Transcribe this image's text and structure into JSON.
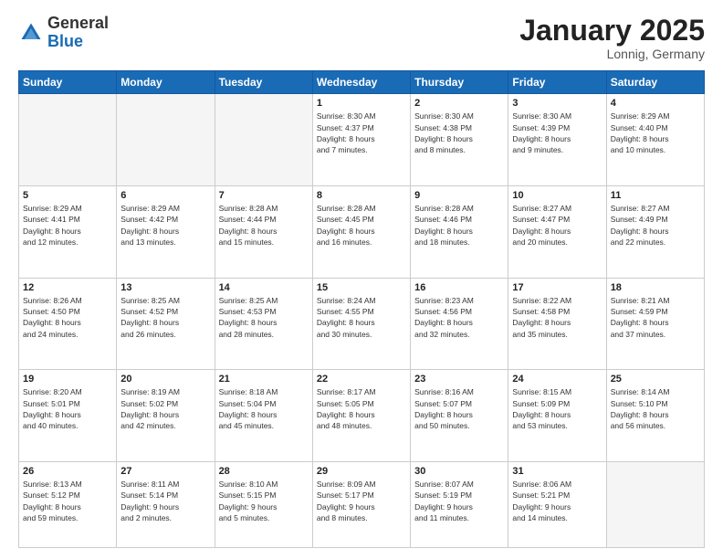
{
  "header": {
    "logo_general": "General",
    "logo_blue": "Blue",
    "month_year": "January 2025",
    "location": "Lonnig, Germany"
  },
  "weekdays": [
    "Sunday",
    "Monday",
    "Tuesday",
    "Wednesday",
    "Thursday",
    "Friday",
    "Saturday"
  ],
  "weeks": [
    [
      {
        "day": "",
        "info": ""
      },
      {
        "day": "",
        "info": ""
      },
      {
        "day": "",
        "info": ""
      },
      {
        "day": "1",
        "info": "Sunrise: 8:30 AM\nSunset: 4:37 PM\nDaylight: 8 hours\nand 7 minutes."
      },
      {
        "day": "2",
        "info": "Sunrise: 8:30 AM\nSunset: 4:38 PM\nDaylight: 8 hours\nand 8 minutes."
      },
      {
        "day": "3",
        "info": "Sunrise: 8:30 AM\nSunset: 4:39 PM\nDaylight: 8 hours\nand 9 minutes."
      },
      {
        "day": "4",
        "info": "Sunrise: 8:29 AM\nSunset: 4:40 PM\nDaylight: 8 hours\nand 10 minutes."
      }
    ],
    [
      {
        "day": "5",
        "info": "Sunrise: 8:29 AM\nSunset: 4:41 PM\nDaylight: 8 hours\nand 12 minutes."
      },
      {
        "day": "6",
        "info": "Sunrise: 8:29 AM\nSunset: 4:42 PM\nDaylight: 8 hours\nand 13 minutes."
      },
      {
        "day": "7",
        "info": "Sunrise: 8:28 AM\nSunset: 4:44 PM\nDaylight: 8 hours\nand 15 minutes."
      },
      {
        "day": "8",
        "info": "Sunrise: 8:28 AM\nSunset: 4:45 PM\nDaylight: 8 hours\nand 16 minutes."
      },
      {
        "day": "9",
        "info": "Sunrise: 8:28 AM\nSunset: 4:46 PM\nDaylight: 8 hours\nand 18 minutes."
      },
      {
        "day": "10",
        "info": "Sunrise: 8:27 AM\nSunset: 4:47 PM\nDaylight: 8 hours\nand 20 minutes."
      },
      {
        "day": "11",
        "info": "Sunrise: 8:27 AM\nSunset: 4:49 PM\nDaylight: 8 hours\nand 22 minutes."
      }
    ],
    [
      {
        "day": "12",
        "info": "Sunrise: 8:26 AM\nSunset: 4:50 PM\nDaylight: 8 hours\nand 24 minutes."
      },
      {
        "day": "13",
        "info": "Sunrise: 8:25 AM\nSunset: 4:52 PM\nDaylight: 8 hours\nand 26 minutes."
      },
      {
        "day": "14",
        "info": "Sunrise: 8:25 AM\nSunset: 4:53 PM\nDaylight: 8 hours\nand 28 minutes."
      },
      {
        "day": "15",
        "info": "Sunrise: 8:24 AM\nSunset: 4:55 PM\nDaylight: 8 hours\nand 30 minutes."
      },
      {
        "day": "16",
        "info": "Sunrise: 8:23 AM\nSunset: 4:56 PM\nDaylight: 8 hours\nand 32 minutes."
      },
      {
        "day": "17",
        "info": "Sunrise: 8:22 AM\nSunset: 4:58 PM\nDaylight: 8 hours\nand 35 minutes."
      },
      {
        "day": "18",
        "info": "Sunrise: 8:21 AM\nSunset: 4:59 PM\nDaylight: 8 hours\nand 37 minutes."
      }
    ],
    [
      {
        "day": "19",
        "info": "Sunrise: 8:20 AM\nSunset: 5:01 PM\nDaylight: 8 hours\nand 40 minutes."
      },
      {
        "day": "20",
        "info": "Sunrise: 8:19 AM\nSunset: 5:02 PM\nDaylight: 8 hours\nand 42 minutes."
      },
      {
        "day": "21",
        "info": "Sunrise: 8:18 AM\nSunset: 5:04 PM\nDaylight: 8 hours\nand 45 minutes."
      },
      {
        "day": "22",
        "info": "Sunrise: 8:17 AM\nSunset: 5:05 PM\nDaylight: 8 hours\nand 48 minutes."
      },
      {
        "day": "23",
        "info": "Sunrise: 8:16 AM\nSunset: 5:07 PM\nDaylight: 8 hours\nand 50 minutes."
      },
      {
        "day": "24",
        "info": "Sunrise: 8:15 AM\nSunset: 5:09 PM\nDaylight: 8 hours\nand 53 minutes."
      },
      {
        "day": "25",
        "info": "Sunrise: 8:14 AM\nSunset: 5:10 PM\nDaylight: 8 hours\nand 56 minutes."
      }
    ],
    [
      {
        "day": "26",
        "info": "Sunrise: 8:13 AM\nSunset: 5:12 PM\nDaylight: 8 hours\nand 59 minutes."
      },
      {
        "day": "27",
        "info": "Sunrise: 8:11 AM\nSunset: 5:14 PM\nDaylight: 9 hours\nand 2 minutes."
      },
      {
        "day": "28",
        "info": "Sunrise: 8:10 AM\nSunset: 5:15 PM\nDaylight: 9 hours\nand 5 minutes."
      },
      {
        "day": "29",
        "info": "Sunrise: 8:09 AM\nSunset: 5:17 PM\nDaylight: 9 hours\nand 8 minutes."
      },
      {
        "day": "30",
        "info": "Sunrise: 8:07 AM\nSunset: 5:19 PM\nDaylight: 9 hours\nand 11 minutes."
      },
      {
        "day": "31",
        "info": "Sunrise: 8:06 AM\nSunset: 5:21 PM\nDaylight: 9 hours\nand 14 minutes."
      },
      {
        "day": "",
        "info": ""
      }
    ]
  ]
}
